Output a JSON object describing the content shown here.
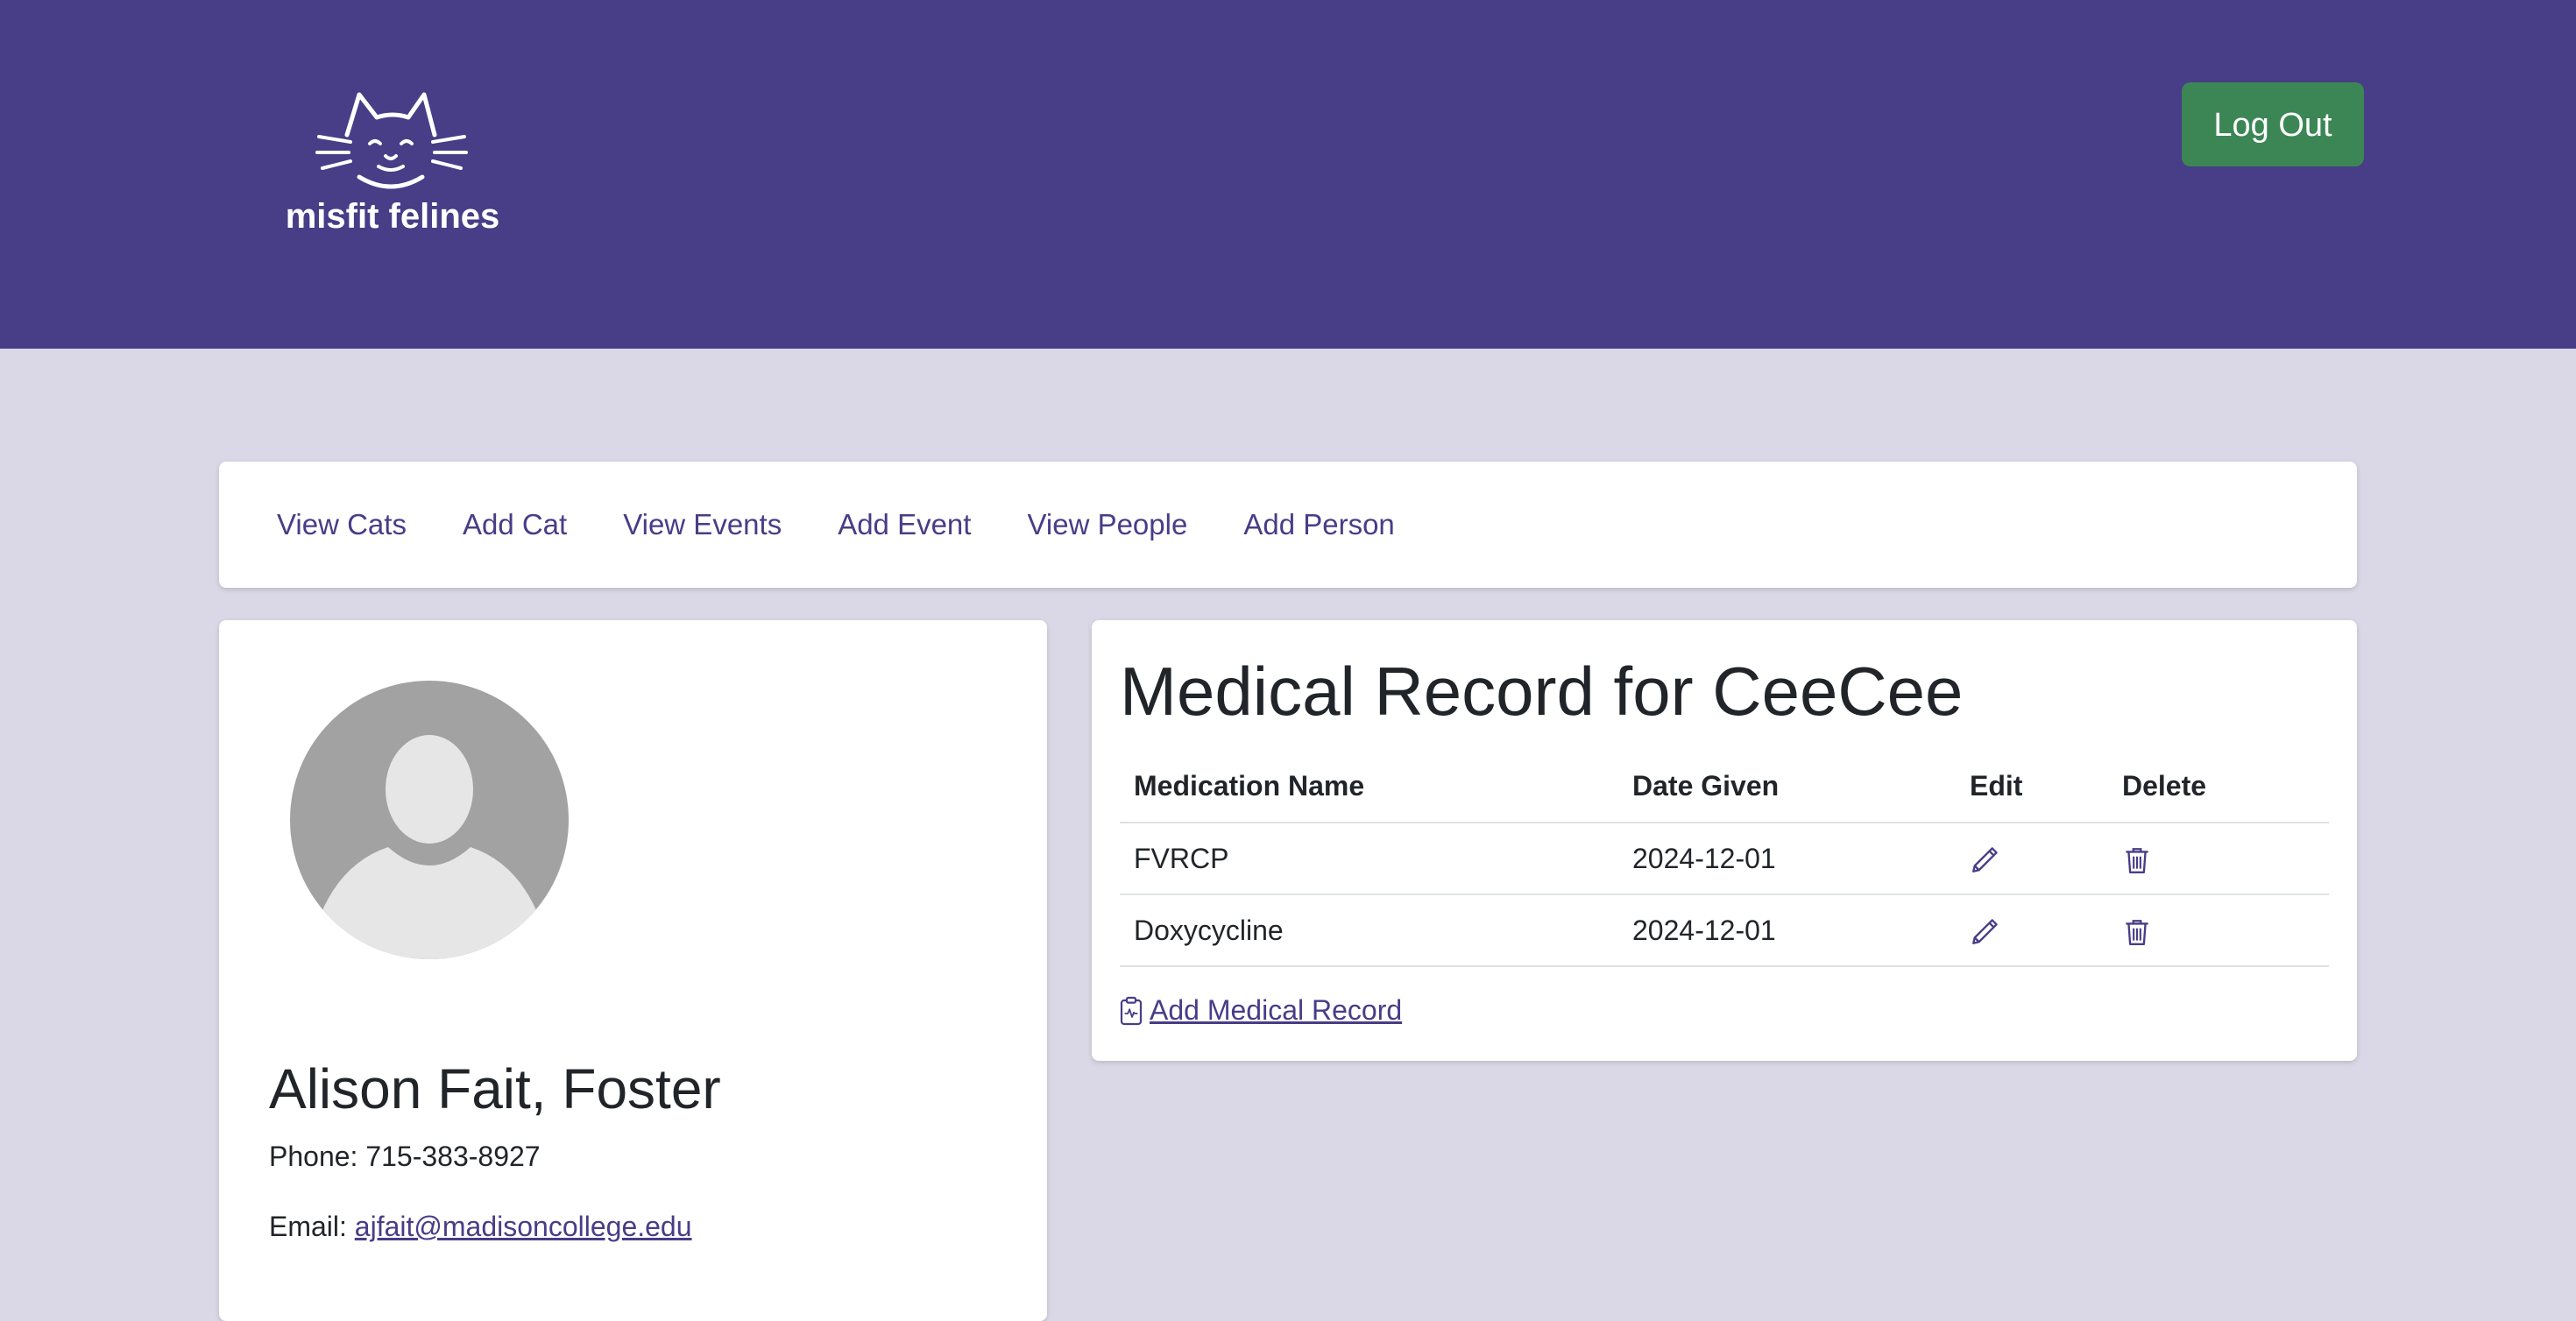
{
  "header": {
    "logo_text": "misfit felines",
    "logout_label": "Log Out"
  },
  "nav": {
    "items": [
      {
        "label": "View Cats"
      },
      {
        "label": "Add Cat"
      },
      {
        "label": "View Events"
      },
      {
        "label": "Add Event"
      },
      {
        "label": "View People"
      },
      {
        "label": "Add Person"
      }
    ]
  },
  "profile": {
    "name": "Alison Fait, Foster",
    "phone_label": "Phone:",
    "phone": "715-383-8927",
    "email_label": "Email:",
    "email": "ajfait@madisoncollege.edu"
  },
  "medical": {
    "title": "Medical Record for CeeCee",
    "columns": [
      "Medication Name",
      "Date Given",
      "Edit",
      "Delete"
    ],
    "rows": [
      {
        "medication": "FVRCP",
        "date": "2024-12-01"
      },
      {
        "medication": "Doxycycline",
        "date": "2024-12-01"
      }
    ],
    "add_label": "Add Medical Record"
  },
  "icons": {
    "edit": "pencil-icon",
    "delete": "trash-icon",
    "add": "clipboard-pulse-icon"
  },
  "colors": {
    "header_bg": "#483d87",
    "page_bg": "#dad8e6",
    "logout_bg": "#3c8655",
    "link": "#483d87"
  }
}
